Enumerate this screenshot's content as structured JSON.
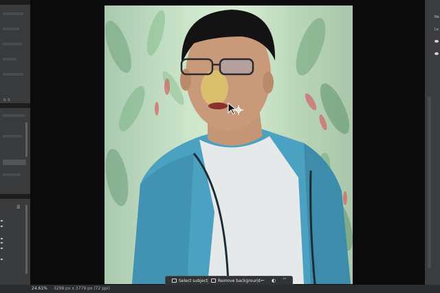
{
  "left_panel": {
    "coord_readout": "0, 0"
  },
  "canvas": {
    "image_description_colors": {
      "wall": "#cde6cc",
      "jacket": "#4fa9c8",
      "shirt": "#e9ecec",
      "hair": "#141414"
    }
  },
  "right_panel": {
    "labels": [
      "Ne",
      "Lo"
    ]
  },
  "task_bar": {
    "select_subject_label": "Select subject",
    "remove_background_label": "Remove background",
    "more_label": "···"
  },
  "status_bar": {
    "zoom": "24.61%",
    "document_size": "3298 px x 3779 px (72 ppi)"
  },
  "icons": {
    "cursor": "move-cursor-icon",
    "select_subject": "select-subject-icon",
    "remove_background": "remove-background-icon",
    "transform": "transform-icon",
    "mask": "mask-icon"
  }
}
